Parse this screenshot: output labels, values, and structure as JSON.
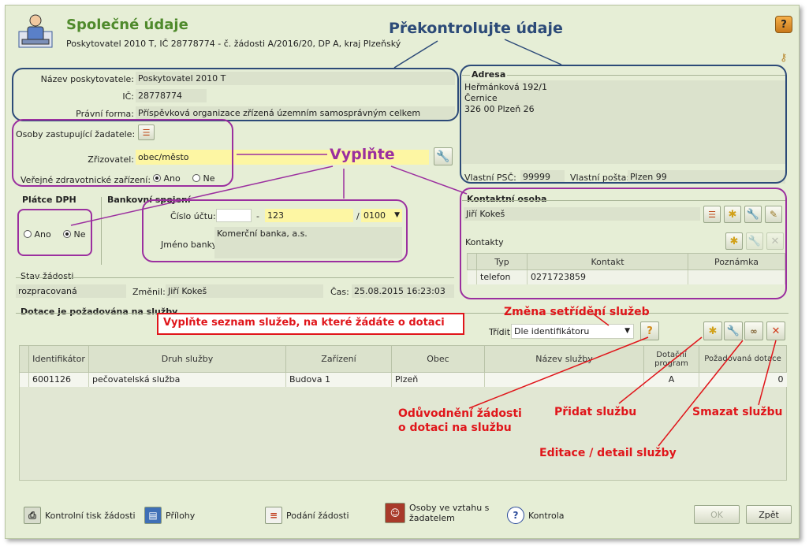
{
  "header": {
    "title": "Společné údaje",
    "subtitle": "Poskytovatel 2010 T, IČ 28778774 - č. žádosti A/2016/20, DP A, kraj Plzeňský",
    "help_icon": "question-icon",
    "key_icon": "key-icon"
  },
  "provider": {
    "name_label": "Název poskytovatele:",
    "name_value": "Poskytovatel 2010 T",
    "ic_label": "IČ:",
    "ic_value": "28778774",
    "legal_label": "Právní forma:",
    "legal_value": "Příspěvková organizace zřízená územním samosprávným celkem"
  },
  "representatives": {
    "persons_label": "Osoby zastupující žadatele:",
    "founder_label": "Zřizovatel:",
    "founder_value": "obec/město",
    "public_health_label": "Veřejné zdravotnické zařízení:",
    "yes_label": "Ano",
    "no_label": "Ne",
    "selected": "Ano"
  },
  "address": {
    "title": "Adresa",
    "line1": "Heřmánková 192/1",
    "line2": "Černice",
    "line3": "326 00 Plzeň 26",
    "psc_label": "Vlastní PSČ:",
    "psc_value": "99999",
    "post_label": "Vlastní pošta:",
    "post_value": "Plzen 99"
  },
  "vat": {
    "title": "Plátce DPH",
    "yes_label": "Ano",
    "no_label": "Ne",
    "selected": "Ne"
  },
  "bank": {
    "title": "Bankovní spojení",
    "account_label": "Číslo účtu:",
    "prefix_value": "",
    "dash": "-",
    "account_value": "123",
    "slash": "/",
    "bank_code": "0100",
    "bank_name_label": "Jméno banky:",
    "bank_name_value": "Komerční banka, a.s."
  },
  "status": {
    "title": "Stav žádosti",
    "state_value": "rozpracovaná",
    "changed_label": "Změnil:",
    "changed_value": "Jiří Kokeš",
    "time_label": "Čas:",
    "time_value": "25.08.2015 16:23:03"
  },
  "contact": {
    "title": "Kontaktní osoba",
    "person_value": "Jiří Kokeš",
    "contacts_label": "Kontakty",
    "columns": [
      "Typ",
      "Kontakt",
      "Poznámka"
    ],
    "rows": [
      {
        "typ": "telefon",
        "kontakt": "0271723859",
        "poznamka": ""
      }
    ]
  },
  "services": {
    "title": "Dotace je požadována na služby",
    "sort_label": "Třídit",
    "sort_value": "Dle identifikátoru",
    "columns": [
      "Identifikátor",
      "Druh služby",
      "Zařízení",
      "Obec",
      "Název služby",
      "Dotační program",
      "Požadovaná dotace"
    ],
    "rows": [
      {
        "id": "6001126",
        "druh": "pečovatelská služba",
        "zarizeni": "Budova 1",
        "obec": "Plzeň",
        "nazev": "",
        "program": "A",
        "dotace": "0"
      }
    ]
  },
  "footer": {
    "print_label": "Kontrolní tisk žádosti",
    "attachments_label": "Přílohy",
    "submit_label": "Podání žádosti",
    "persons_label_1": "Osoby ve vztahu s",
    "persons_label_2": "žadatelem",
    "check_label": "Kontrola",
    "ok_label": "OK",
    "back_label": "Zpět"
  },
  "annotations": {
    "check_data": "Překontrolujte údaje",
    "fill_in": "Vyplňte",
    "fill_services": "Vyplňte seznam služeb, na které žádáte o dotaci",
    "sort_change": "Změna setřídění služeb",
    "justification_1": "Odůvodnění  žádosti",
    "justification_2": "o dotaci na službu",
    "add_service": "Přidat službu",
    "delete_service": "Smazat službu",
    "edit_service": "Editace / detail služby"
  },
  "colors": {
    "background": "#e6eed6",
    "title_green": "#4f8a2c",
    "annotation_blue": "#2c4a78",
    "annotation_purple": "#9b2f9f",
    "annotation_red": "#e0151a",
    "editable_yellow": "#fdf6a3"
  }
}
